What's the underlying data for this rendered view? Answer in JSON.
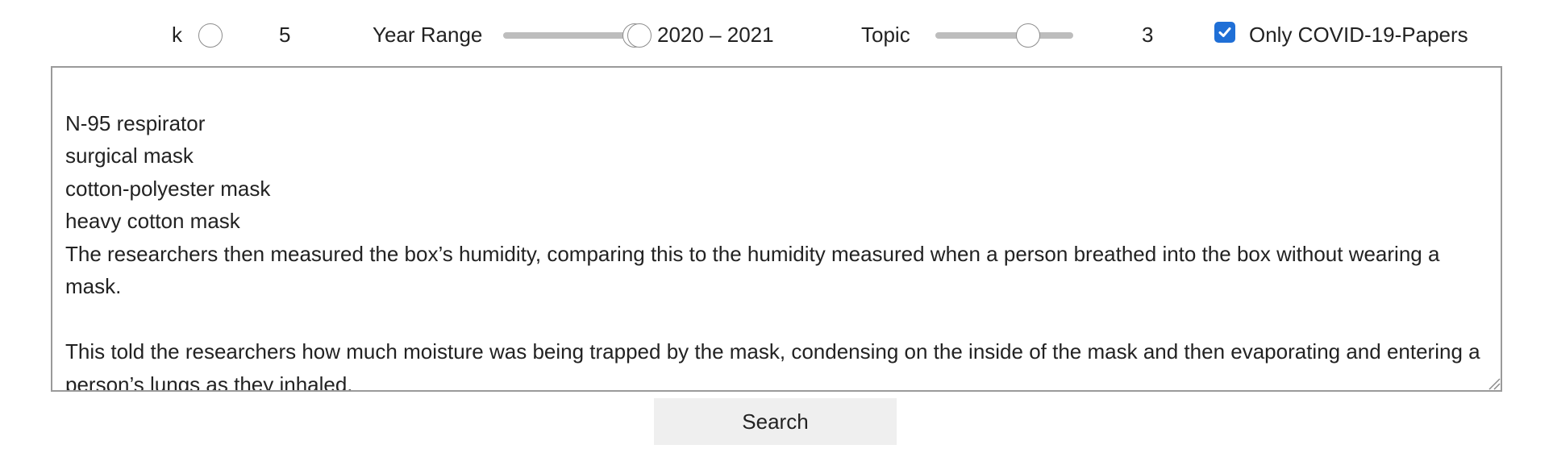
{
  "controls": {
    "k": {
      "label": "k",
      "value": "5",
      "level": 0
    },
    "year_range": {
      "label": "Year Range",
      "value_text": "2020 – 2021",
      "low": 2020,
      "high": 2021
    },
    "topic": {
      "label": "Topic",
      "value": "3"
    },
    "covid_filter": {
      "label": "Only COVID-19-Papers",
      "checked": true
    }
  },
  "query": {
    "lines": [
      "",
      "N-95 respirator",
      "surgical mask",
      "cotton-polyester mask",
      "heavy cotton mask",
      "The researchers then measured the box’s humidity, comparing this to the humidity measured when a person breathed into the box without wearing a mask.",
      "",
      "This told the researchers how much moisture was being trapped by the mask, condensing on the inside of the mask and then evaporating and entering a person’s lungs as they inhaled."
    ]
  },
  "search_button": {
    "label": "Search"
  },
  "colors": {
    "accent": "#1f6fd6",
    "track": "#bdbdbd",
    "button_bg": "#efefef",
    "textarea_border": "#9a9a9a"
  },
  "icons": {
    "checkbox": "checkmark-icon",
    "resize": "resize-grip-icon"
  }
}
